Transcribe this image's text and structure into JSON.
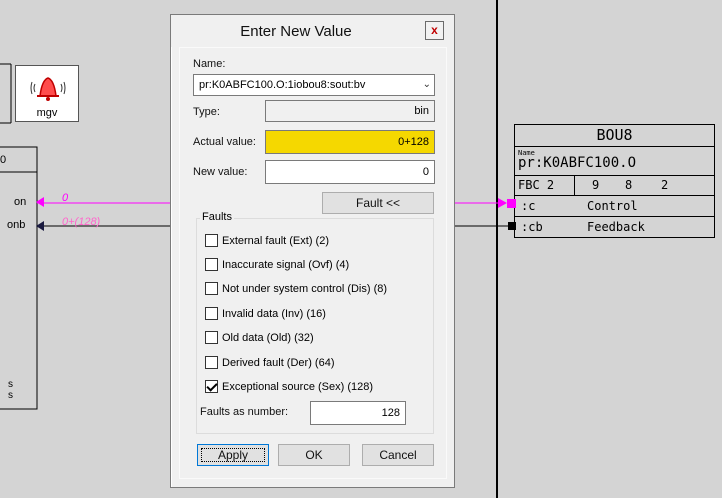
{
  "background": {
    "alarm_label": "mgv",
    "left_block": {
      "header": "0",
      "pin_on": "on",
      "pin_onb": "onb",
      "signal_on_value": "0",
      "signal_onb_value": "0+(128)",
      "bottom_s1": "s",
      "bottom_s2": "s"
    },
    "bou8": {
      "title": "BOU8",
      "name_caption": "Name",
      "name": "pr:K0ABFC100.O",
      "fbc_label": "FBC 2",
      "num1": "9",
      "num2": "8",
      "num3": "2",
      "pin_c": ":c",
      "pin_c_desc": "Control",
      "pin_cb": ":cb",
      "pin_cb_desc": "Feedback"
    },
    "colors": {
      "signal_magenta": "#ff00ff",
      "signal_pink": "#ff66cc",
      "alarm_red": "#e00000"
    }
  },
  "dialog": {
    "title": "Enter New Value",
    "close_glyph": "x",
    "name_label": "Name:",
    "name_value": "pr:K0ABFC100.O:1iobou8:sout:bv",
    "type_label": "Type:",
    "type_value": "bin",
    "actual_label": "Actual value:",
    "actual_value": "0+128",
    "new_label": "New value:",
    "new_value": "0",
    "fault_button": "Fault <<",
    "faults_group": "Faults",
    "faults": [
      {
        "label": "External fault (Ext) (2)",
        "checked": false
      },
      {
        "label": "Inaccurate signal (Ovf) (4)",
        "checked": false
      },
      {
        "label": "Not under system control (Dis) (8)",
        "checked": false
      },
      {
        "label": "Invalid data (Inv) (16)",
        "checked": false
      },
      {
        "label": "Old data (Old) (32)",
        "checked": false
      },
      {
        "label": "Derived fault (Der) (64)",
        "checked": false
      },
      {
        "label": "Exceptional source (Sex) (128)",
        "checked": true
      }
    ],
    "faults_number_label": "Faults as number:",
    "faults_number_value": "128",
    "apply": "Apply",
    "ok": "OK",
    "cancel": "Cancel",
    "highlight_color": "#f5d800"
  }
}
